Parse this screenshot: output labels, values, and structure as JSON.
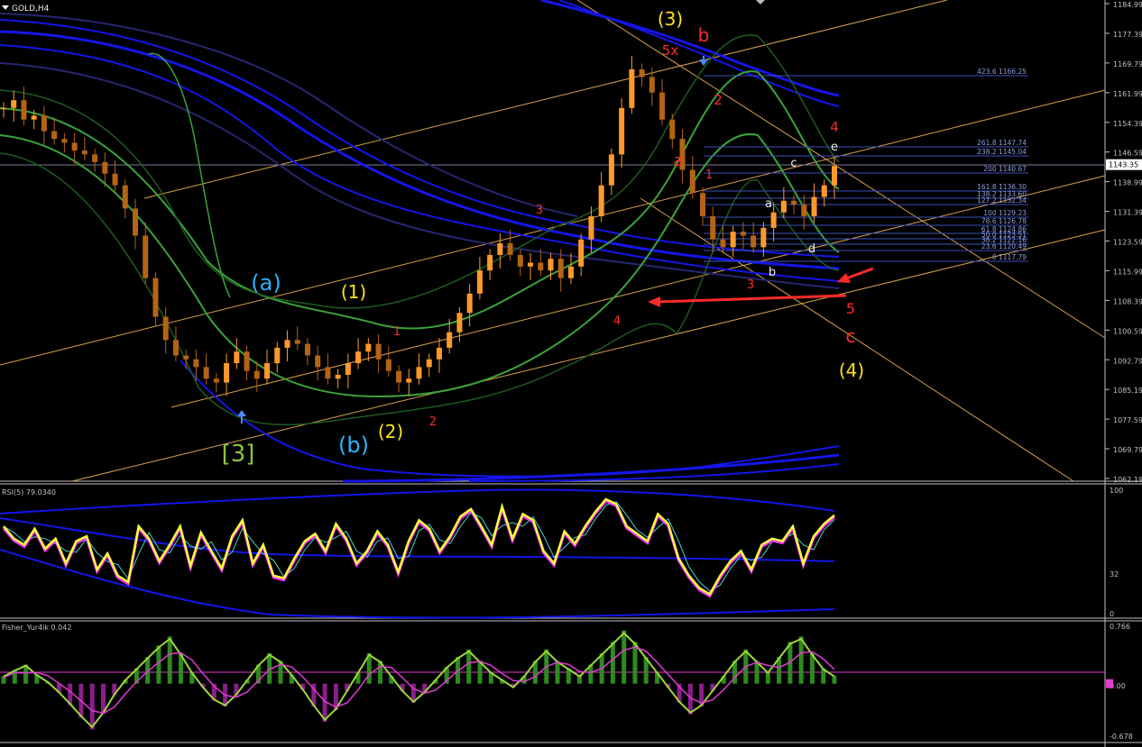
{
  "window": {
    "symbol_label": "GOLD,H4"
  },
  "colors": {
    "background": "#000000",
    "axis": "#c0c0c0",
    "grid": "#808080",
    "candle": "#ff9a2a",
    "candle_dark": "#b46414",
    "ma_blue": "#1515e8",
    "ma_dark": "#262672",
    "band_green": "#3aa33a",
    "band_dark": "#1f5a1f",
    "channel": "#d9a24a",
    "fib": "#3d4fb8",
    "rsi_main": "#ffff3a",
    "rsi_shadow": "#ff30ff",
    "rsi_signal": "#4fd0d0",
    "fisher_line": "#9ed83a",
    "fisher_signal": "#e03cd0",
    "hist_pos": "#2e8b1e",
    "hist_neg": "#8a1e8a",
    "label_red": "#ff2a2a",
    "label_yellow": "#ffe31a",
    "label_blue": "#2ab4ff",
    "label_green": "#8cc43a",
    "label_white": "#f0f0f0",
    "arrow_blue": "#4a8cff"
  },
  "main_panel": {
    "price_axis": [
      "1184.99",
      "1177.39",
      "1169.79",
      "1161.99",
      "1154.39",
      "1146.59",
      "1138.99",
      "1131.39",
      "1123.59",
      "1115.99",
      "1108.39",
      "1100.59",
      "1092.79",
      "1085.19",
      "1077.59",
      "1069.79",
      "1062.19"
    ],
    "current_price": "1143.35",
    "fib_levels": [
      {
        "text": "423.6 1166.25"
      },
      {
        "text": "261.8 1147.74"
      },
      {
        "text": "238.2 1145.04"
      },
      {
        "text": "200 1140.67"
      },
      {
        "text": "161.8 1136.30"
      },
      {
        "text": "138.2 1133.60"
      },
      {
        "text": "127.2 1132.34"
      },
      {
        "text": "100 1129.23"
      },
      {
        "text": "78.6 1126.78"
      },
      {
        "text": "61.8 1124.86"
      },
      {
        "text": "50.0 1123.51"
      },
      {
        "text": "38.2 1122.16"
      },
      {
        "text": "23.6 1120.49"
      },
      {
        "text": "0 1117.79"
      }
    ],
    "wave_labels": [
      {
        "text": "(3)",
        "color": "label_yellow"
      },
      {
        "text": "b",
        "color": "label_red"
      },
      {
        "text": "5x",
        "color": "label_red"
      },
      {
        "text": "2",
        "color": "label_red"
      },
      {
        "text": "4",
        "color": "label_red"
      },
      {
        "text": "e",
        "color": "label_white"
      },
      {
        "text": "a",
        "color": "label_red"
      },
      {
        "text": "1",
        "color": "label_red"
      },
      {
        "text": "c",
        "color": "label_white"
      },
      {
        "text": "a",
        "color": "label_white"
      },
      {
        "text": "d",
        "color": "label_white"
      },
      {
        "text": "b",
        "color": "label_white"
      },
      {
        "text": "3",
        "color": "label_red"
      },
      {
        "text": "3",
        "color": "label_red"
      },
      {
        "text": "4",
        "color": "label_red"
      },
      {
        "text": "5",
        "color": "label_red"
      },
      {
        "text": "c",
        "color": "label_red"
      },
      {
        "text": "(4)",
        "color": "label_yellow"
      },
      {
        "text": "(a)",
        "color": "label_blue"
      },
      {
        "text": "(1)",
        "color": "label_yellow"
      },
      {
        "text": "1",
        "color": "label_red"
      },
      {
        "text": "(2)",
        "color": "label_yellow"
      },
      {
        "text": "2",
        "color": "label_red"
      },
      {
        "text": "(b)",
        "color": "label_blue"
      },
      {
        "text": "[3]",
        "color": "label_green"
      }
    ]
  },
  "rsi_panel": {
    "title": "RSI(5) 79.0340",
    "axis": [
      "100",
      "32",
      "0"
    ]
  },
  "fisher_panel": {
    "title": "Fisher_Yur4ik 0.042",
    "axis": [
      "0.766",
      "0.00",
      "-0.678"
    ]
  },
  "chart_data": [
    {
      "type": "line",
      "title": "GOLD,H4",
      "ylim": [
        1062.19,
        1184.99
      ],
      "series": [
        {
          "values": [
            1158,
            1160,
            1155,
            1156,
            1152,
            1150,
            1149,
            1147,
            1146,
            1144,
            1141,
            1138,
            1132,
            1125,
            1114,
            1104,
            1098,
            1094,
            1093,
            1091,
            1088,
            1087,
            1092,
            1095,
            1090,
            1088,
            1092,
            1096,
            1098,
            1097,
            1094,
            1091,
            1088,
            1089,
            1092,
            1095,
            1097,
            1093,
            1090,
            1087,
            1088,
            1091,
            1093,
            1096,
            1100,
            1105,
            1110,
            1116,
            1120,
            1123,
            1120,
            1117,
            1118,
            1116,
            1119,
            1114,
            1117,
            1124,
            1130,
            1138,
            1146,
            1158,
            1168,
            1166,
            1162,
            1155,
            1150,
            1142,
            1136,
            1130,
            1124,
            1122,
            1126,
            1125,
            1122,
            1127,
            1131,
            1134,
            1133,
            1130,
            1135,
            1138,
            1143
          ]
        }
      ]
    },
    {
      "type": "line",
      "title": "RSI(5) 79.0340",
      "ylim": [
        0,
        100
      ],
      "series": [
        {
          "values": [
            70,
            60,
            55,
            68,
            52,
            60,
            40,
            58,
            62,
            35,
            48,
            30,
            25,
            70,
            60,
            42,
            55,
            70,
            38,
            65,
            50,
            36,
            62,
            75,
            40,
            55,
            30,
            28,
            44,
            58,
            64,
            50,
            72,
            60,
            40,
            50,
            66,
            55,
            33,
            58,
            75,
            68,
            50,
            62,
            78,
            84,
            70,
            55,
            86,
            60,
            80,
            75,
            50,
            40,
            66,
            56,
            70,
            82,
            92,
            88,
            70,
            64,
            58,
            80,
            72,
            44,
            30,
            20,
            15,
            30,
            42,
            50,
            35,
            55,
            60,
            58,
            70,
            40,
            62,
            72,
            79
          ]
        }
      ]
    },
    {
      "type": "bar",
      "title": "Fisher_Yur4ik 0.042",
      "ylim": [
        -0.678,
        0.766
      ],
      "series": [
        {
          "values": [
            0.1,
            0.18,
            0.25,
            0.12,
            0.02,
            -0.12,
            -0.28,
            -0.45,
            -0.6,
            -0.4,
            -0.15,
            0.05,
            0.2,
            0.35,
            0.5,
            0.62,
            0.4,
            0.15,
            -0.05,
            -0.22,
            -0.3,
            -0.15,
            0.05,
            0.25,
            0.4,
            0.3,
            0.12,
            -0.08,
            -0.3,
            -0.5,
            -0.35,
            -0.1,
            0.15,
            0.4,
            0.3,
            0.1,
            -0.1,
            -0.25,
            -0.12,
            0.05,
            0.22,
            0.35,
            0.45,
            0.3,
            0.15,
            0.05,
            -0.05,
            0.1,
            0.3,
            0.45,
            0.3,
            0.2,
            0.1,
            0.25,
            0.4,
            0.55,
            0.7,
            0.55,
            0.35,
            0.15,
            -0.05,
            -0.25,
            -0.4,
            -0.3,
            -0.1,
            0.1,
            0.3,
            0.45,
            0.3,
            0.15,
            0.35,
            0.55,
            0.62,
            0.4,
            0.2,
            0.1
          ]
        }
      ]
    }
  ]
}
